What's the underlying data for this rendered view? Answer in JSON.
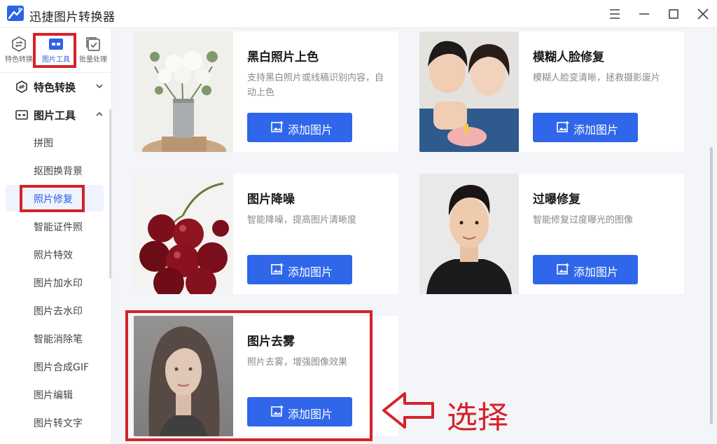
{
  "app": {
    "title": "迅捷图片转换器"
  },
  "window_controls": [
    "menu-icon",
    "minimize-icon",
    "maximize-icon",
    "close-icon"
  ],
  "rail": {
    "items": [
      {
        "label": "特色转换",
        "icon": "convert-icon",
        "active": false
      },
      {
        "label": "图片工具",
        "icon": "image-tools-icon",
        "active": true
      },
      {
        "label": "批量处理",
        "icon": "batch-icon",
        "active": false
      }
    ]
  },
  "sidebar": {
    "groups": [
      {
        "label": "特色转换",
        "icon": "convert-icon",
        "expanded": false
      },
      {
        "label": "图片工具",
        "icon": "image-tools-icon",
        "expanded": true
      }
    ],
    "items": [
      "拼图",
      "抠图换背景",
      "照片修复",
      "智能证件照",
      "照片特效",
      "图片加水印",
      "图片去水印",
      "智能消除笔",
      "图片合成GIF",
      "图片编辑",
      "图片转文字"
    ],
    "active_item": "照片修复"
  },
  "cards": [
    {
      "title": "黑白照片上色",
      "desc": "支持黑白照片或线稿识别内容，自动上色",
      "button": "添加图片",
      "thumb": "flowers-vase"
    },
    {
      "title": "模糊人脸修复",
      "desc": "模糊人脸变清晰，拯救摄影废片",
      "button": "添加图片",
      "thumb": "couple-photo"
    },
    {
      "title": "图片降噪",
      "desc": "智能降噪，提高图片清晰度",
      "button": "添加图片",
      "thumb": "cherries"
    },
    {
      "title": "过曝修复",
      "desc": "智能修复过度曝光的图像",
      "button": "添加图片",
      "thumb": "man-portrait"
    },
    {
      "title": "图片去雾",
      "desc": "照片去雾，增强图像效果",
      "button": "添加图片",
      "thumb": "woman-portrait"
    }
  ],
  "annotation": {
    "text": "选择",
    "color": "#d6222a"
  },
  "colors": {
    "accent": "#2f66ea",
    "highlight": "#d6222a"
  }
}
